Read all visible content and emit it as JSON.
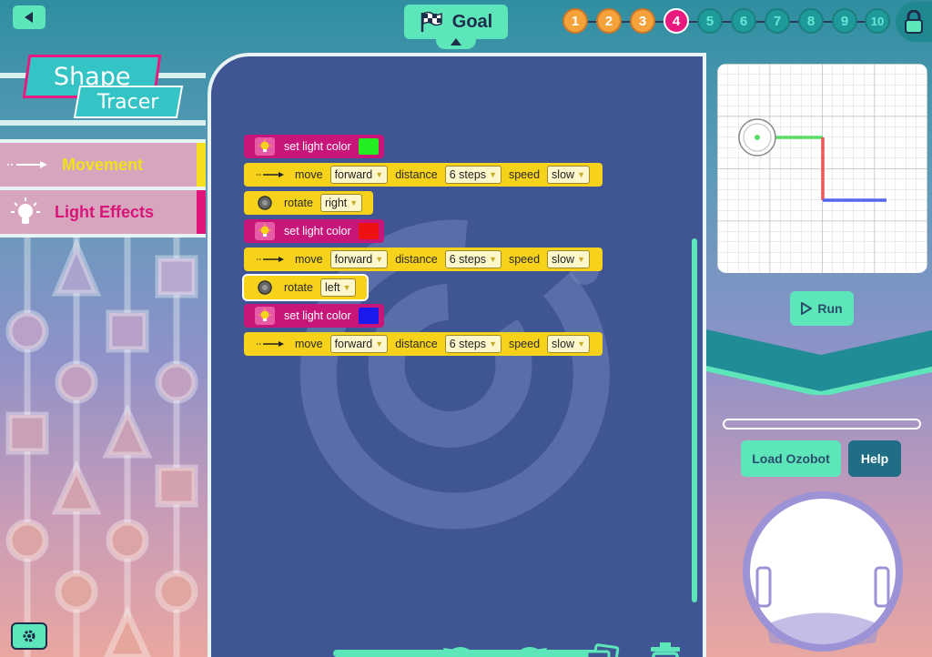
{
  "header": {
    "goal_label": "Goal",
    "levels": [
      {
        "num": "1",
        "state": "done"
      },
      {
        "num": "2",
        "state": "done"
      },
      {
        "num": "3",
        "state": "done"
      },
      {
        "num": "4",
        "state": "current"
      },
      {
        "num": "5",
        "state": "future"
      },
      {
        "num": "6",
        "state": "future"
      },
      {
        "num": "7",
        "state": "future"
      },
      {
        "num": "8",
        "state": "future"
      },
      {
        "num": "9",
        "state": "future"
      },
      {
        "num": "10",
        "state": "future"
      }
    ]
  },
  "logo": {
    "line1": "Shape",
    "line2": "Tracer"
  },
  "sidebar": {
    "categories": [
      {
        "label": "Movement",
        "icon": "arrow-icon"
      },
      {
        "label": "Light Effects",
        "icon": "lightbulb-icon"
      }
    ]
  },
  "workspace": {
    "blocks": [
      {
        "type": "light",
        "label": "set light color",
        "color": "#22ee22"
      },
      {
        "type": "move",
        "label": "move",
        "direction": "forward",
        "distance_label": "distance",
        "distance": "6 steps",
        "speed_label": "speed",
        "speed": "slow"
      },
      {
        "type": "rotate",
        "label": "rotate",
        "direction": "right"
      },
      {
        "type": "light",
        "label": "set light color",
        "color": "#ee1111"
      },
      {
        "type": "move",
        "label": "move",
        "direction": "forward",
        "distance_label": "distance",
        "distance": "6 steps",
        "speed_label": "speed",
        "speed": "slow"
      },
      {
        "type": "rotate",
        "label": "rotate",
        "direction": "left"
      },
      {
        "type": "light",
        "label": "set light color",
        "color": "#1a1aee"
      },
      {
        "type": "move",
        "label": "move",
        "direction": "forward",
        "distance_label": "distance",
        "distance": "6 steps",
        "speed_label": "speed",
        "speed": "slow"
      }
    ]
  },
  "right_panel": {
    "run_label": "Run",
    "load_label": "Load Ozobot",
    "help_label": "Help"
  },
  "colors": {
    "accent": "#5ce6b9",
    "pink": "#c8157a",
    "yellow": "#f6d21a",
    "workspace_bg": "#3f5594"
  }
}
